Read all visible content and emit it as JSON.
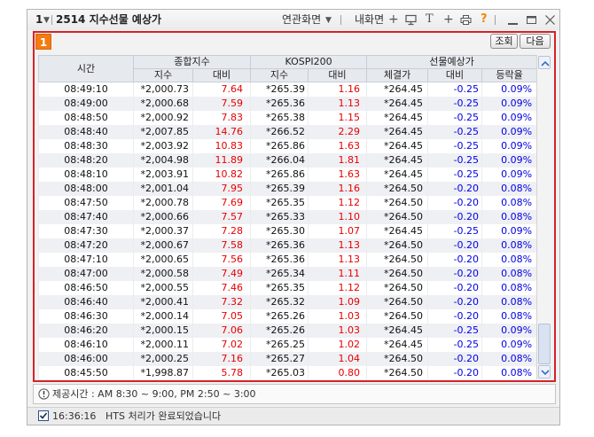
{
  "window": {
    "screen_number": "1",
    "title": "2514 지수선물 예상가",
    "related_screens_label": "연관화면",
    "my_screen_label": "내화면",
    "icons": [
      "dropdown-icon",
      "add-icon",
      "monitor-icon",
      "text-icon",
      "plus-icon",
      "printer-icon",
      "help-icon",
      "minimize-icon",
      "maximize-icon",
      "close-icon"
    ]
  },
  "panel": {
    "badge": "1",
    "query_button": "조회",
    "next_button": "다음"
  },
  "table": {
    "headers": {
      "time": "시간",
      "composite": "종합지수",
      "kospi200": "KOSPI200",
      "futures": "선물예상가",
      "composite_index": "지수",
      "composite_change": "대비",
      "kospi_index": "지수",
      "kospi_change": "대비",
      "fut_price": "체결가",
      "fut_change": "대비",
      "fut_rate": "등락율"
    },
    "rows": [
      {
        "time": "08:49:10",
        "composite_index": "*2,000.73",
        "composite_change": "7.64",
        "kospi_index": "*265.39",
        "kospi_change": "1.16",
        "fut_price": "*264.45",
        "fut_change": "-0.25",
        "fut_rate": "0.09%"
      },
      {
        "time": "08:49:00",
        "composite_index": "*2,000.68",
        "composite_change": "7.59",
        "kospi_index": "*265.36",
        "kospi_change": "1.13",
        "fut_price": "*264.45",
        "fut_change": "-0.25",
        "fut_rate": "0.09%"
      },
      {
        "time": "08:48:50",
        "composite_index": "*2,000.92",
        "composite_change": "7.83",
        "kospi_index": "*265.38",
        "kospi_change": "1.15",
        "fut_price": "*264.45",
        "fut_change": "-0.25",
        "fut_rate": "0.09%"
      },
      {
        "time": "08:48:40",
        "composite_index": "*2,007.85",
        "composite_change": "14.76",
        "kospi_index": "*266.52",
        "kospi_change": "2.29",
        "fut_price": "*264.45",
        "fut_change": "-0.25",
        "fut_rate": "0.09%"
      },
      {
        "time": "08:48:30",
        "composite_index": "*2,003.92",
        "composite_change": "10.83",
        "kospi_index": "*265.86",
        "kospi_change": "1.63",
        "fut_price": "*264.45",
        "fut_change": "-0.25",
        "fut_rate": "0.09%"
      },
      {
        "time": "08:48:20",
        "composite_index": "*2,004.98",
        "composite_change": "11.89",
        "kospi_index": "*266.04",
        "kospi_change": "1.81",
        "fut_price": "*264.45",
        "fut_change": "-0.25",
        "fut_rate": "0.09%"
      },
      {
        "time": "08:48:10",
        "composite_index": "*2,003.91",
        "composite_change": "10.82",
        "kospi_index": "*265.86",
        "kospi_change": "1.63",
        "fut_price": "*264.45",
        "fut_change": "-0.25",
        "fut_rate": "0.09%"
      },
      {
        "time": "08:48:00",
        "composite_index": "*2,001.04",
        "composite_change": "7.95",
        "kospi_index": "*265.39",
        "kospi_change": "1.16",
        "fut_price": "*264.50",
        "fut_change": "-0.20",
        "fut_rate": "0.08%"
      },
      {
        "time": "08:47:50",
        "composite_index": "*2,000.78",
        "composite_change": "7.69",
        "kospi_index": "*265.35",
        "kospi_change": "1.12",
        "fut_price": "*264.50",
        "fut_change": "-0.20",
        "fut_rate": "0.08%"
      },
      {
        "time": "08:47:40",
        "composite_index": "*2,000.66",
        "composite_change": "7.57",
        "kospi_index": "*265.33",
        "kospi_change": "1.10",
        "fut_price": "*264.50",
        "fut_change": "-0.20",
        "fut_rate": "0.08%"
      },
      {
        "time": "08:47:30",
        "composite_index": "*2,000.37",
        "composite_change": "7.28",
        "kospi_index": "*265.30",
        "kospi_change": "1.07",
        "fut_price": "*264.45",
        "fut_change": "-0.25",
        "fut_rate": "0.09%"
      },
      {
        "time": "08:47:20",
        "composite_index": "*2,000.67",
        "composite_change": "7.58",
        "kospi_index": "*265.36",
        "kospi_change": "1.13",
        "fut_price": "*264.50",
        "fut_change": "-0.20",
        "fut_rate": "0.08%"
      },
      {
        "time": "08:47:10",
        "composite_index": "*2,000.65",
        "composite_change": "7.56",
        "kospi_index": "*265.36",
        "kospi_change": "1.13",
        "fut_price": "*264.50",
        "fut_change": "-0.20",
        "fut_rate": "0.08%"
      },
      {
        "time": "08:47:00",
        "composite_index": "*2,000.58",
        "composite_change": "7.49",
        "kospi_index": "*265.34",
        "kospi_change": "1.11",
        "fut_price": "*264.50",
        "fut_change": "-0.20",
        "fut_rate": "0.08%"
      },
      {
        "time": "08:46:50",
        "composite_index": "*2,000.55",
        "composite_change": "7.46",
        "kospi_index": "*265.35",
        "kospi_change": "1.12",
        "fut_price": "*264.50",
        "fut_change": "-0.20",
        "fut_rate": "0.08%"
      },
      {
        "time": "08:46:40",
        "composite_index": "*2,000.41",
        "composite_change": "7.32",
        "kospi_index": "*265.32",
        "kospi_change": "1.09",
        "fut_price": "*264.50",
        "fut_change": "-0.20",
        "fut_rate": "0.08%"
      },
      {
        "time": "08:46:30",
        "composite_index": "*2,000.14",
        "composite_change": "7.05",
        "kospi_index": "*265.26",
        "kospi_change": "1.03",
        "fut_price": "*264.50",
        "fut_change": "-0.20",
        "fut_rate": "0.08%"
      },
      {
        "time": "08:46:20",
        "composite_index": "*2,000.15",
        "composite_change": "7.06",
        "kospi_index": "*265.26",
        "kospi_change": "1.03",
        "fut_price": "*264.45",
        "fut_change": "-0.25",
        "fut_rate": "0.09%"
      },
      {
        "time": "08:46:10",
        "composite_index": "*2,000.11",
        "composite_change": "7.02",
        "kospi_index": "*265.25",
        "kospi_change": "1.02",
        "fut_price": "*264.45",
        "fut_change": "-0.25",
        "fut_rate": "0.09%"
      },
      {
        "time": "08:46:00",
        "composite_index": "*2,000.25",
        "composite_change": "7.16",
        "kospi_index": "*265.27",
        "kospi_change": "1.04",
        "fut_price": "*264.50",
        "fut_change": "-0.20",
        "fut_rate": "0.08%"
      },
      {
        "time": "08:45:50",
        "composite_index": "*1,998.87",
        "composite_change": "5.78",
        "kospi_index": "*265.03",
        "kospi_change": "0.80",
        "fut_price": "*264.50",
        "fut_change": "-0.20",
        "fut_rate": "0.08%"
      }
    ]
  },
  "info": {
    "text": "제공시간 : AM 8:30 ~ 9:00, PM 2:50 ~ 3:00"
  },
  "status": {
    "time": "16:36:16",
    "message": "HTS 처리가 완료되었습니다"
  },
  "colors": {
    "up": "#e60000",
    "down": "#0000e6",
    "accent": "#d4232a",
    "badge": "#f47b10",
    "row_alt": "#eff0f4",
    "help": "#f08c00"
  }
}
